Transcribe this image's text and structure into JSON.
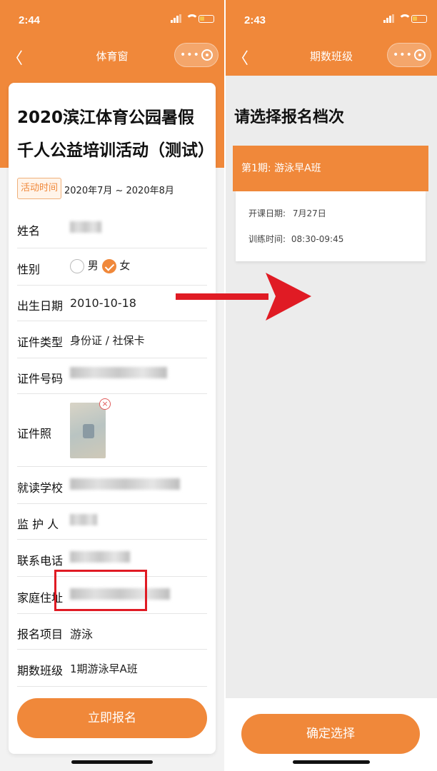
{
  "left": {
    "status": {
      "time": "2:44"
    },
    "nav": {
      "title": "体育窗",
      "back": "〈",
      "more": "•••"
    },
    "activity_title": "2020滨江体育公园暑假千人公益培训活动（测试）",
    "time_tag": "活动时间",
    "time_range": "2020年7月 ~ 2020年8月",
    "form": {
      "name_label": "姓名",
      "gender_label": "性别",
      "gender_male": "男",
      "gender_female": "女",
      "birth_label": "出生日期",
      "birth_value": "2010-10-18",
      "id_type_label": "证件类型",
      "id_type_value": "身份证 / 社保卡",
      "id_number_label": "证件号码",
      "id_photo_label": "证件照",
      "school_label": "就读学校",
      "guardian_label": "监 护 人",
      "phone_label": "联系电话",
      "address_label": "家庭住址",
      "item_label": "报名项目",
      "item_value": "游泳",
      "class_label": "期数班级",
      "class_value": "1期游泳早A班"
    },
    "submit_button": "立即报名"
  },
  "right": {
    "status": {
      "time": "2:43"
    },
    "nav": {
      "title": "期数班级",
      "back": "〈",
      "more": "•••"
    },
    "heading": "请选择报名档次",
    "period": {
      "title": "第1期: 游泳早A班",
      "start_label": "开课日期:",
      "start_value": "7月27日",
      "train_label": "训练时间:",
      "train_value": "08:30-09:45"
    },
    "confirm_button": "确定选择"
  },
  "colors": {
    "brand": "#f0883a",
    "annotation_red": "#e01b24"
  },
  "icons": [
    "signal-icon",
    "wifi-icon",
    "battery-icon",
    "back-chevron-icon",
    "more-dots-icon",
    "close-mini-program-icon",
    "check-icon",
    "delete-icon",
    "arrow-annotation"
  ]
}
